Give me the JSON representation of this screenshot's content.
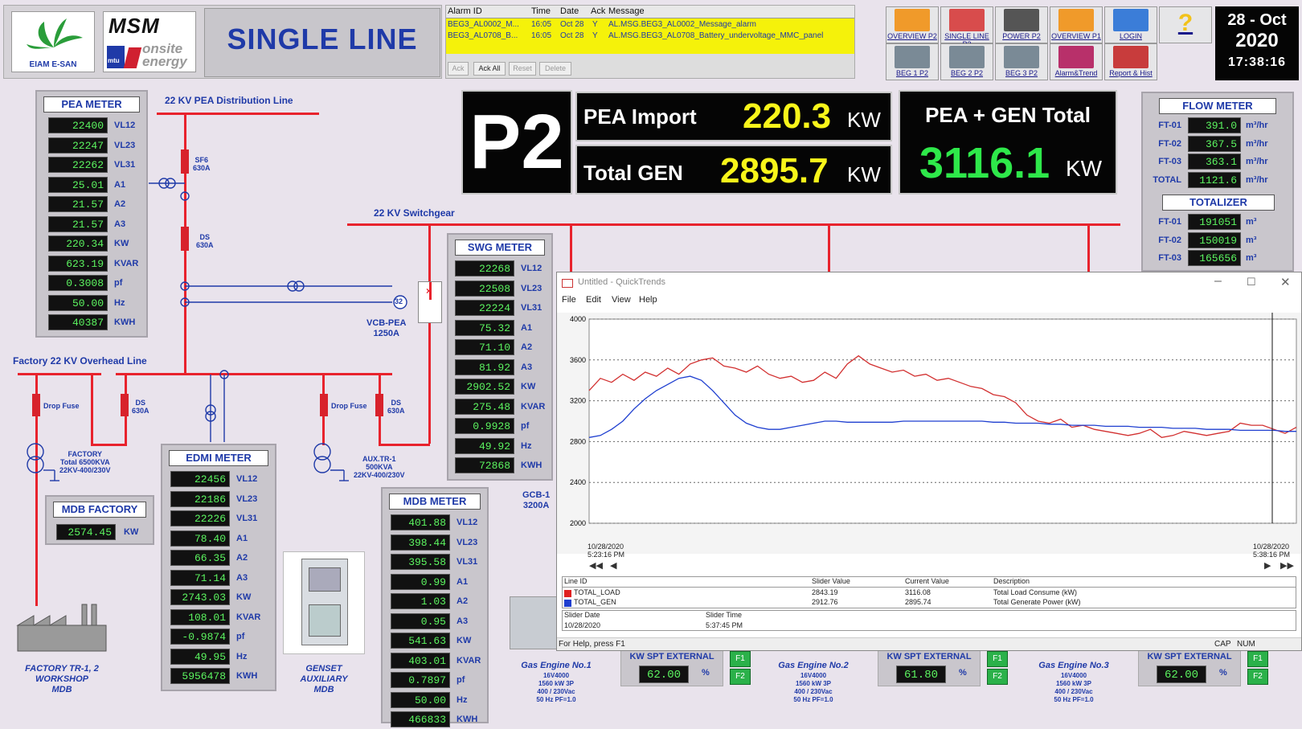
{
  "header": {
    "logo1": "EIAM E-SAN",
    "logo2_top": "MSM",
    "logo2_sub": "onsite energy",
    "logo2_mtu": "mtu",
    "title": "SINGLE LINE",
    "date_day": "28 - Oct",
    "date_year": "2020",
    "time": "17:38:16"
  },
  "alarm": {
    "columns": [
      "Alarm ID",
      "Time",
      "Date",
      "Ack",
      "Message"
    ],
    "rows": [
      [
        "BEG3_AL0002_M...",
        "16:05",
        "Oct 28",
        "Y",
        "AL.MSG.BEG3_AL0002_Message_alarm"
      ],
      [
        "BEG3_AL0708_B...",
        "16:05",
        "Oct 28",
        "Y",
        "AL.MSG.BEG3_AL0708_Battery_undervoltage_MMC_panel"
      ]
    ],
    "buttons": [
      "Ack",
      "Ack All",
      "Reset",
      "Delete"
    ]
  },
  "nav": [
    {
      "label": "OVERVIEW P2",
      "color": "#f09a2a"
    },
    {
      "label": "SINGLE LINE P2",
      "color": "#d84c4c"
    },
    {
      "label": "POWER P2",
      "color": "#444"
    },
    {
      "label": "OVERVIEW P1",
      "color": "#f09a2a"
    },
    {
      "label": "LOGIN",
      "color": "#3b7dd8"
    },
    {
      "label": "",
      "color": "#f2c21a"
    },
    {
      "label": "BEG 1 P2",
      "color": "#7a8a96"
    },
    {
      "label": "BEG 2 P2",
      "color": "#7a8a96"
    },
    {
      "label": "BEG 3 P2",
      "color": "#7a8a96"
    },
    {
      "label": "Alarm&Trend",
      "color": "#b8306a"
    },
    {
      "label": "Report & Hist",
      "color": "#c83c3c"
    }
  ],
  "p2": "P2",
  "pea_import": {
    "label": "PEA Import",
    "value": "220.3",
    "unit": "KW"
  },
  "total_gen": {
    "label": "Total GEN",
    "value": "2895.7",
    "unit": "KW"
  },
  "pea_gen_total": {
    "label": "PEA + GEN Total",
    "value": "3116.1",
    "unit": "KW"
  },
  "pea_meter": {
    "title": "PEA METER",
    "rows": [
      [
        "22400",
        "VL12"
      ],
      [
        "22247",
        "VL23"
      ],
      [
        "22262",
        "VL31"
      ],
      [
        "25.01",
        "A1"
      ],
      [
        "21.57",
        "A2"
      ],
      [
        "21.57",
        "A3"
      ],
      [
        "220.34",
        "KW"
      ],
      [
        "623.19",
        "KVAR"
      ],
      [
        "0.3008",
        "pf"
      ],
      [
        "50.00",
        "Hz"
      ],
      [
        "40387",
        "KWH"
      ]
    ]
  },
  "swg_meter": {
    "title": "SWG METER",
    "rows": [
      [
        "22268",
        "VL12"
      ],
      [
        "22508",
        "VL23"
      ],
      [
        "22224",
        "VL31"
      ],
      [
        "75.32",
        "A1"
      ],
      [
        "71.10",
        "A2"
      ],
      [
        "81.92",
        "A3"
      ],
      [
        "2902.52",
        "KW"
      ],
      [
        "275.48",
        "KVAR"
      ],
      [
        "0.9928",
        "pf"
      ],
      [
        "49.92",
        "Hz"
      ],
      [
        "72868",
        "KWH"
      ]
    ]
  },
  "edmi_meter": {
    "title": "EDMI METER",
    "rows": [
      [
        "22456",
        "VL12"
      ],
      [
        "22186",
        "VL23"
      ],
      [
        "22226",
        "VL31"
      ],
      [
        "78.40",
        "A1"
      ],
      [
        "66.35",
        "A2"
      ],
      [
        "71.14",
        "A3"
      ],
      [
        "2743.03",
        "KW"
      ],
      [
        "108.01",
        "KVAR"
      ],
      [
        "-0.9874",
        "pf"
      ],
      [
        "49.95",
        "Hz"
      ],
      [
        "5956478",
        "KWH"
      ]
    ]
  },
  "mdb_meter": {
    "title": "MDB METER",
    "rows": [
      [
        "401.88",
        "VL12"
      ],
      [
        "398.44",
        "VL23"
      ],
      [
        "395.58",
        "VL31"
      ],
      [
        "0.99",
        "A1"
      ],
      [
        "1.03",
        "A2"
      ],
      [
        "0.95",
        "A3"
      ],
      [
        "541.63",
        "KW"
      ],
      [
        "403.01",
        "KVAR"
      ],
      [
        "0.7897",
        "pf"
      ],
      [
        "50.00",
        "Hz"
      ],
      [
        "466833",
        "KWH"
      ]
    ]
  },
  "mdb_factory": {
    "title": "MDB FACTORY",
    "value": "2574.45",
    "unit": "KW"
  },
  "flow_meter": {
    "title": "FLOW METER",
    "rows": [
      [
        "FT-01",
        "391.0",
        "m³/hr"
      ],
      [
        "FT-02",
        "367.5",
        "m³/hr"
      ],
      [
        "FT-03",
        "363.1",
        "m³/hr"
      ],
      [
        "TOTAL",
        "1121.6",
        "m³/hr"
      ]
    ]
  },
  "totalizer": {
    "title": "TOTALIZER",
    "rows": [
      [
        "FT-01",
        "191051",
        "m³"
      ],
      [
        "FT-02",
        "150019",
        "m³"
      ],
      [
        "FT-03",
        "165656",
        "m³"
      ]
    ]
  },
  "diagram": {
    "pea_line": "22 KV PEA Distribution Line",
    "switchgear": "22 KV Switchgear",
    "overhead": "Factory 22 KV Overhead Line",
    "sf6": "SF6",
    "sf6_a": "630A",
    "ds1": "DS",
    "ds1_a": "630A",
    "ct": "32",
    "vcb": "VCB-PEA",
    "vcb_a": "1250A",
    "drop_fuse1": "Drop Fuse",
    "ds2": "DS",
    "ds2_a": "630A",
    "drop_fuse2": "Drop Fuse",
    "ds3": "DS",
    "ds3_a": "630A",
    "factory_tr": [
      "FACTORY",
      "Total 6500KVA",
      "22KV-400/230V"
    ],
    "aux_tr": [
      "AUX.TR-1",
      "500KVA",
      "22KV-400/230V"
    ],
    "gcb": "GCB-1",
    "gcb_a": "3200A",
    "factory_label": [
      "FACTORY TR-1, 2",
      "WORKSHOP",
      "MDB"
    ],
    "genset_label": [
      "GENSET",
      "AUXILIARY",
      "MDB"
    ]
  },
  "engines": [
    {
      "name": "Gas Engine No.1",
      "spec": [
        "16V4000",
        "1560 kW 3P",
        "400 / 230Vac",
        "50 Hz PF=1.0"
      ],
      "spt_label": "KW SPT EXTERNAL",
      "spt": "62.00",
      "unit": "%",
      "f1": "F1",
      "f2": "F2"
    },
    {
      "name": "Gas Engine No.2",
      "spec": [
        "16V4000",
        "1560 kW 3P",
        "400 / 230Vac",
        "50 Hz PF=1.0"
      ],
      "spt_label": "KW SPT EXTERNAL",
      "spt": "61.80",
      "unit": "%",
      "f1": "F1",
      "f2": "F2"
    },
    {
      "name": "Gas Engine No.3",
      "spec": [
        "16V4000",
        "1560 kW 3P",
        "400 / 230Vac",
        "50 Hz PF=1.0"
      ],
      "spt_label": "KW SPT EXTERNAL",
      "spt": "62.00",
      "unit": "%",
      "f1": "F1",
      "f2": "F2"
    }
  ],
  "trend": {
    "title": "Untitled - QuickTrends",
    "menu": [
      "File",
      "Edit",
      "View",
      "Help"
    ],
    "x_start": [
      "10/28/2020",
      "5:23:16 PM"
    ],
    "x_end": [
      "10/28/2020",
      "5:38:16 PM"
    ],
    "table_headers": [
      "Line ID",
      "Slider Value",
      "Current Value",
      "Description"
    ],
    "table_rows": [
      {
        "id": "TOTAL_LOAD",
        "slider": "2843.19",
        "current": "3116.08",
        "desc": "Total Load Consume (kW)",
        "color": "#e02020"
      },
      {
        "id": "TOTAL_GEN",
        "slider": "2912.76",
        "current": "2895.74",
        "desc": "Total Generate Power (kW)",
        "color": "#1f3fd0"
      }
    ],
    "slider_date_label": "Slider Date",
    "slider_time_label": "Slider Time",
    "slider_date": "10/28/2020",
    "slider_time": "5:37:45 PM",
    "status": "For Help, press F1",
    "caps": "CAP",
    "num": "NUM"
  },
  "chart_data": {
    "type": "line",
    "ylim": [
      2000,
      4000
    ],
    "yticks": [
      2000,
      2400,
      2800,
      3200,
      3600,
      4000
    ],
    "x_start": "10/28/2020 5:23:16 PM",
    "x_end": "10/28/2020 5:38:16 PM",
    "grid": true,
    "series": [
      {
        "name": "TOTAL_LOAD",
        "color": "#d23030",
        "values": [
          3300,
          3420,
          3380,
          3460,
          3400,
          3480,
          3440,
          3520,
          3460,
          3560,
          3600,
          3620,
          3540,
          3520,
          3480,
          3540,
          3460,
          3420,
          3440,
          3380,
          3400,
          3480,
          3420,
          3560,
          3640,
          3560,
          3520,
          3480,
          3500,
          3440,
          3460,
          3400,
          3420,
          3380,
          3340,
          3320,
          3260,
          3240,
          3180,
          3060,
          3000,
          2980,
          3020,
          2940,
          2960,
          2920,
          2900,
          2880,
          2860,
          2880,
          2920,
          2840,
          2860,
          2900,
          2880,
          2860,
          2880,
          2900,
          2980,
          2960,
          2960,
          2920,
          2880,
          2940
        ]
      },
      {
        "name": "TOTAL_GEN",
        "color": "#1f3fd0",
        "values": [
          2840,
          2860,
          2920,
          3000,
          3120,
          3220,
          3300,
          3360,
          3420,
          3440,
          3400,
          3300,
          3180,
          3060,
          2980,
          2940,
          2920,
          2920,
          2940,
          2960,
          2980,
          3000,
          3000,
          2990,
          2990,
          2990,
          2990,
          2990,
          3000,
          3000,
          3000,
          3000,
          3000,
          3000,
          3000,
          3000,
          2990,
          2990,
          2980,
          2980,
          2980,
          2970,
          2970,
          2960,
          2960,
          2960,
          2950,
          2950,
          2950,
          2940,
          2940,
          2940,
          2930,
          2930,
          2930,
          2920,
          2920,
          2920,
          2910,
          2910,
          2910,
          2910,
          2900,
          2900
        ]
      }
    ]
  }
}
